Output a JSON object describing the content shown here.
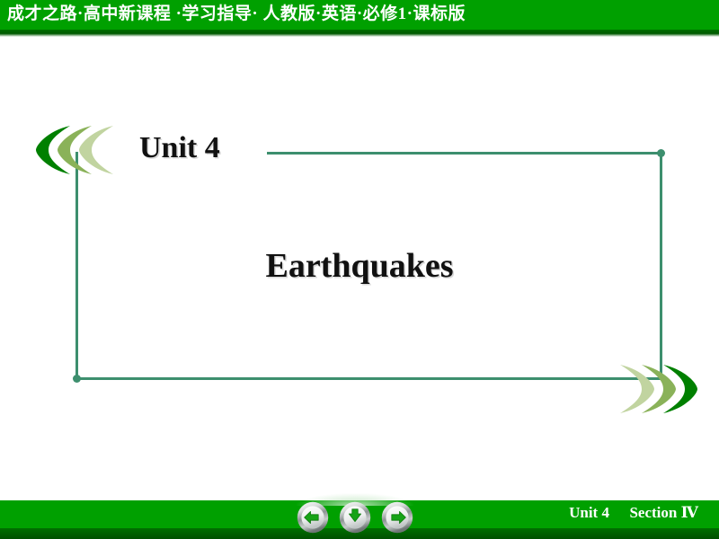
{
  "header": {
    "title": "成才之路·高中新课程 ·学习指导· 人教版·英语·必修1·课标版",
    "bg_color": "#00a000",
    "text_color": "#ffffff"
  },
  "slide": {
    "unit_label": "Unit 4",
    "lesson_title": "Earthquakes",
    "frame_color": "#3d8f6e",
    "chevrons": {
      "left": {
        "name": "chevron-cluster-left",
        "colors": [
          "#008000",
          "#8ab259",
          "#c1d4a0"
        ]
      },
      "right": {
        "name": "chevron-cluster-right",
        "colors": [
          "#c1d4a0",
          "#8ab259",
          "#008000"
        ]
      }
    }
  },
  "footer": {
    "bg_color": "#00a000",
    "unit_label": "Unit 4",
    "section_label": "Section Ⅳ",
    "nav": [
      {
        "name": "previous-button",
        "icon": "arrow-left-icon",
        "direction": "left"
      },
      {
        "name": "down-button",
        "icon": "arrow-down-icon",
        "direction": "down"
      },
      {
        "name": "next-button",
        "icon": "arrow-right-icon",
        "direction": "right"
      }
    ]
  }
}
